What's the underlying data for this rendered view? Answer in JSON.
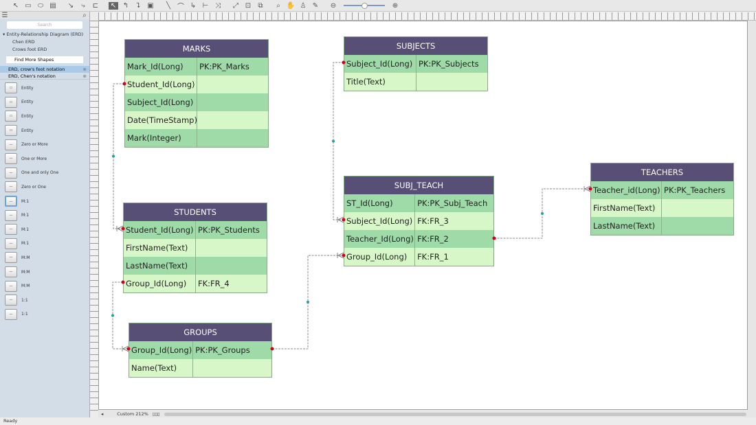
{
  "toolbar": {
    "icons": [
      "pointer-icon",
      "rectangle-icon",
      "ellipse-icon",
      "text-icon",
      "connector-icon",
      "curved-connector-icon",
      "tree-connector-icon",
      "select-icon",
      "smart-connector-icon",
      "route-icon",
      "layout-icon",
      "line-icon",
      "arc-icon",
      "polyline-icon",
      "bezier-icon",
      "spline-icon",
      "fit-icon",
      "zoom-region-icon",
      "group-icon",
      "search-icon",
      "hand-icon",
      "stamp-icon",
      "eyedropper-icon",
      "zoom-out-icon",
      "zoom-in-icon"
    ]
  },
  "sidebar": {
    "search_placeholder": "Search",
    "tree": [
      "▾ Entity-Relationship Diagram (ERD)",
      "Chen ERD",
      "Crows foot ERD"
    ],
    "find_more": "Find More Shapes",
    "libraries": [
      "ERD, crow's foot notation",
      "ERD, Chen's notation"
    ],
    "shapes": [
      "Entity",
      "Entity",
      "Entity",
      "Entity",
      "Zero or More",
      "One or More",
      "One and only One",
      "Zero or One",
      "M:1",
      "M:1",
      "M:1",
      "M:1",
      "M:M",
      "M:M",
      "M:M",
      "1:1",
      "1:1"
    ]
  },
  "zoom_label": "Custom 212%",
  "status": "Ready",
  "colors": {
    "header": "#574f75",
    "row_dark": "#9fdaa9",
    "row_light": "#d8f7c8",
    "connector": "#888888",
    "endpoint": "#d0021b",
    "midpoint": "#2a9d9d"
  },
  "entities": [
    {
      "name": "MARKS",
      "rows": [
        [
          "Mark_Id(Long)",
          "PK:PK_Marks"
        ],
        [
          "Student_Id(Long)",
          ""
        ],
        [
          "Subject_Id(Long)",
          ""
        ],
        [
          "Date(TimeStamp)",
          ""
        ],
        [
          "Mark(Integer)",
          ""
        ]
      ]
    },
    {
      "name": "SUBJECTS",
      "rows": [
        [
          "Subject_Id(Long)",
          "PK:PK_Subjects"
        ],
        [
          "Title(Text)",
          ""
        ]
      ]
    },
    {
      "name": "STUDENTS",
      "rows": [
        [
          "Student_Id(Long)",
          "PK:PK_Students"
        ],
        [
          "FirstName(Text)",
          ""
        ],
        [
          "LastName(Text)",
          ""
        ],
        [
          "Group_Id(Long)",
          "FK:FR_4"
        ]
      ]
    },
    {
      "name": "GROUPS",
      "rows": [
        [
          "Group_Id(Long)",
          "PK:PK_Groups"
        ],
        [
          "Name(Text)",
          ""
        ]
      ]
    },
    {
      "name": "SUBJ_TEACH",
      "rows": [
        [
          "ST_Id(Long)",
          "PK:PK_Subj_Teach"
        ],
        [
          "Subject_Id(Long)",
          "FK:FR_3"
        ],
        [
          "Teacher_Id(Long)",
          "FK:FR_2"
        ],
        [
          "Group_Id(Long)",
          "FK:FR_1"
        ]
      ]
    },
    {
      "name": "TEACHERS",
      "rows": [
        [
          "Teacher_id(Long)",
          "PK:PK_Teachers"
        ],
        [
          "FirstName(Text)",
          ""
        ],
        [
          "LastName(Text)",
          ""
        ]
      ]
    }
  ]
}
